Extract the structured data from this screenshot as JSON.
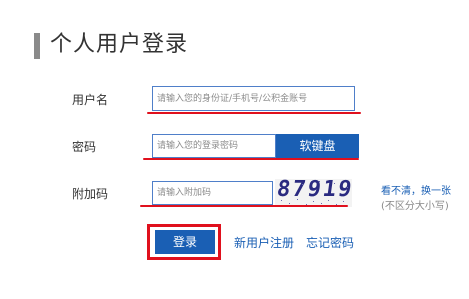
{
  "page": {
    "title": "个人用户登录"
  },
  "form": {
    "username_label": "用户名",
    "username_placeholder": "请输入您的身份证/手机号/公积金账号",
    "password_label": "密码",
    "password_placeholder": "请输入您的登录密码",
    "soft_keyboard_label": "软键盘",
    "captcha_label": "附加码",
    "captcha_placeholder": "请输入附加码",
    "captcha_text": "87919",
    "refresh_text": "看不清，换一张",
    "case_hint": "(不区分大小写)"
  },
  "actions": {
    "login_label": "登录",
    "register_label": "新用户注册",
    "forgot_label": "忘记密码"
  },
  "colors": {
    "primary": "#1a5fb4",
    "highlight": "#e0101d",
    "input_border": "#4f7fc9"
  }
}
